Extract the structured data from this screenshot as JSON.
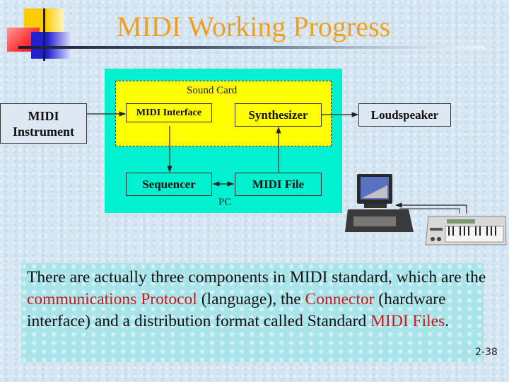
{
  "slide": {
    "title": "MIDI Working Progress",
    "page_number": "2-38",
    "page_number_visible": "2-38"
  },
  "diagram": {
    "midi_instrument": "MIDI Instrument",
    "midi_instrument_line1": "MIDI",
    "midi_instrument_line2": "Instrument",
    "sound_card_label": "Sound Card",
    "midi_interface": "MIDI Interface",
    "synthesizer": "Synthesizer",
    "loudspeaker": "Loudspeaker",
    "sequencer": "Sequencer",
    "midi_file": "MIDI File",
    "pc_label": "PC",
    "colors": {
      "pc": "#00f0d0",
      "sound_card": "#ffff00"
    }
  },
  "body": {
    "p1": "There are actually three components in MIDI standard, which are the ",
    "h1": "communications Protocol",
    "p2": " (language), the ",
    "h2": "Connector",
    "p3": " (hardware interface) and a distribution format called Standard ",
    "h3": "MIDI Files",
    "p4": "."
  }
}
